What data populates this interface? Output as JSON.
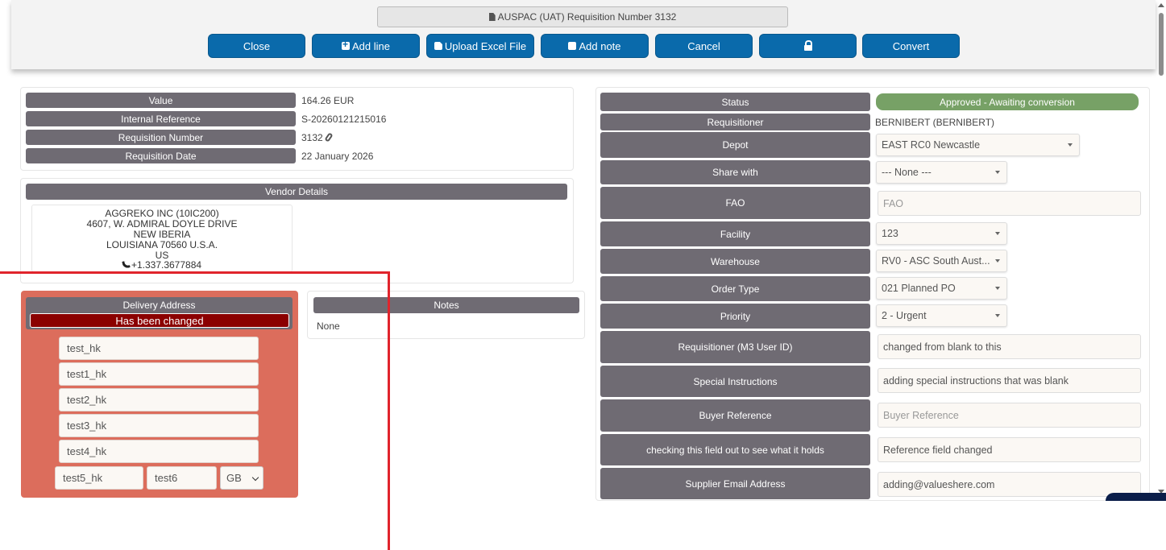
{
  "header": {
    "title": "AUSPAC (UAT) Requisition Number 3132",
    "buttons": {
      "close": "Close",
      "add_line": "Add line",
      "upload_excel": "Upload Excel File",
      "add_note": "Add note",
      "cancel": "Cancel",
      "lock": "",
      "convert": "Convert"
    }
  },
  "summary": [
    {
      "label": "Value",
      "value": "164.26 EUR"
    },
    {
      "label": "Internal Reference",
      "value": "S-20260121215016"
    },
    {
      "label": "Requisition Number",
      "value": "3132"
    },
    {
      "label": "Requisition Date",
      "value": "22 January 2026"
    }
  ],
  "vendor": {
    "heading": "Vendor Details",
    "lines": [
      "AGGREKO INC (10IC200)",
      "4607, W. ADMIRAL DOYLE DRIVE",
      "NEW IBERIA",
      "LOUISIANA 70560 U.S.A.",
      "US"
    ],
    "phone": "+1.337.3677884"
  },
  "delivery": {
    "heading": "Delivery Address",
    "changed_banner": "Has been changed",
    "lines": [
      "test_hk",
      "test1_hk",
      "test2_hk",
      "test3_hk",
      "test4_hk"
    ],
    "city": "test5_hk",
    "postcode": "test6",
    "country": "GB"
  },
  "notes": {
    "heading": "Notes",
    "text": "None"
  },
  "details": {
    "status": {
      "label": "Status",
      "value": "Approved - Awaiting conversion"
    },
    "requisitioner": {
      "label": "Requisitioner",
      "value": "BERNIBERT (BERNIBERT)"
    },
    "depot": {
      "label": "Depot",
      "value": "EAST RC0 Newcastle"
    },
    "share_with": {
      "label": "Share with",
      "value": "--- None ---"
    },
    "fao": {
      "label": "FAO",
      "placeholder": "FAO"
    },
    "facility": {
      "label": "Facility",
      "value": "123"
    },
    "warehouse": {
      "label": "Warehouse",
      "value": "RV0 - ASC South Aust..."
    },
    "order_type": {
      "label": "Order Type",
      "value": "021 Planned PO"
    },
    "priority": {
      "label": "Priority",
      "value": "2 - Urgent"
    },
    "m3_user": {
      "label": "Requisitioner (M3 User ID)",
      "value": "changed from blank to this"
    },
    "special_instructions": {
      "label": "Special Instructions",
      "value": "adding special instructions that was blank"
    },
    "buyer_reference": {
      "label": "Buyer Reference",
      "placeholder": "Buyer Reference"
    },
    "checking_field": {
      "label": "checking this field out to see what it holds",
      "value": "Reference field changed"
    },
    "supplier_email": {
      "label": "Supplier Email Address",
      "value": "adding@valueshere.com"
    }
  }
}
